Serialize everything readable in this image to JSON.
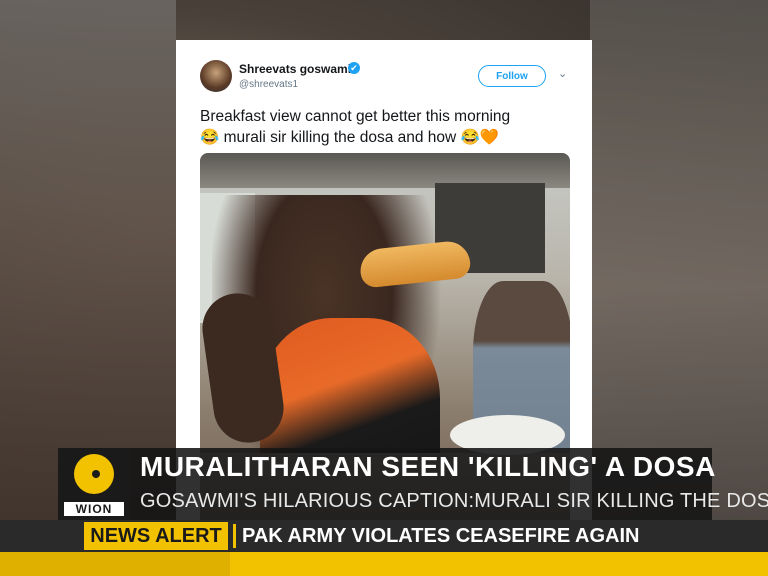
{
  "tweet": {
    "display_name": "Shreevats goswami",
    "handle": "@shreevats1",
    "follow_label": "Follow",
    "text_line1": "Breakfast view cannot get better this morning",
    "text_line2": "😂 murali sir killing the dosa and how 😂🧡",
    "verified_icon": "✔",
    "more_icon": "⌄"
  },
  "lower_third": {
    "logo_text": "WION",
    "headline": "MURALITHARAN SEEN 'KILLING' A DOSA",
    "subhead": "GOSAWMI'S HILARIOUS CAPTION:MURALI SIR KILLING THE DOSA"
  },
  "ticker": {
    "label": "NEWS ALERT",
    "text": "PAK ARMY VIOLATES CEASEFIRE AGAIN"
  },
  "colors": {
    "brand_yellow": "#f2c200",
    "twitter_blue": "#1da1f2"
  }
}
